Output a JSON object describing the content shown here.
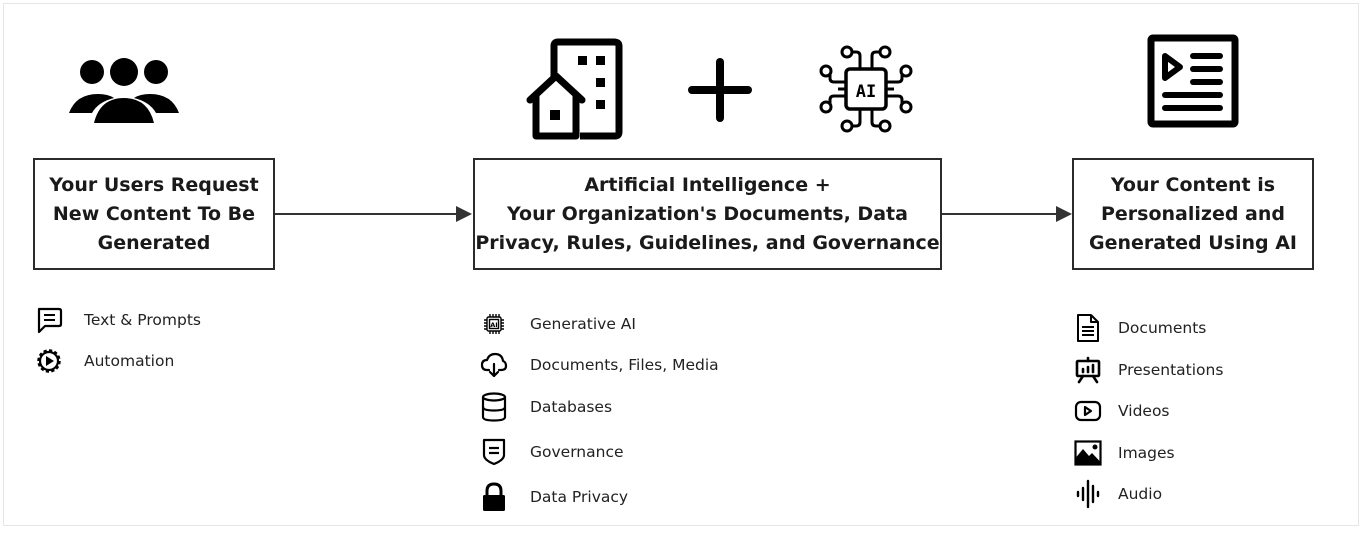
{
  "stages": [
    {
      "icon": "users-group-icon",
      "title": "Your Users Request\nNew Content To Be\nGenerated",
      "items": [
        {
          "icon": "chat-message-icon",
          "label": "Text & Prompts"
        },
        {
          "icon": "automation-gear-play-icon",
          "label": "Automation"
        }
      ]
    },
    {
      "icons": [
        "building-house-icon",
        "plus-icon",
        "ai-chip-icon"
      ],
      "title": "Artificial Intelligence +\nYour Organization's Documents, Data\nPrivacy, Rules, Guidelines, and Governance",
      "items": [
        {
          "icon": "ai-chip-small-icon",
          "label": "Generative AI"
        },
        {
          "icon": "cloud-download-icon",
          "label": "Documents, Files, Media"
        },
        {
          "icon": "database-icon",
          "label": "Databases"
        },
        {
          "icon": "shield-icon",
          "label": "Governance"
        },
        {
          "icon": "lock-icon",
          "label": "Data Privacy"
        }
      ]
    },
    {
      "icon": "media-document-icon",
      "title": "Your Content is\nPersonalized and\nGenerated Using AI",
      "items": [
        {
          "icon": "document-icon",
          "label": "Documents"
        },
        {
          "icon": "presentation-icon",
          "label": "Presentations"
        },
        {
          "icon": "video-play-icon",
          "label": "Videos"
        },
        {
          "icon": "image-icon",
          "label": "Images"
        },
        {
          "icon": "audio-wave-icon",
          "label": "Audio"
        }
      ]
    }
  ],
  "colors": {
    "stroke": "#2b2b2b",
    "icon": "#000000",
    "frame": "#e6e6e6"
  }
}
